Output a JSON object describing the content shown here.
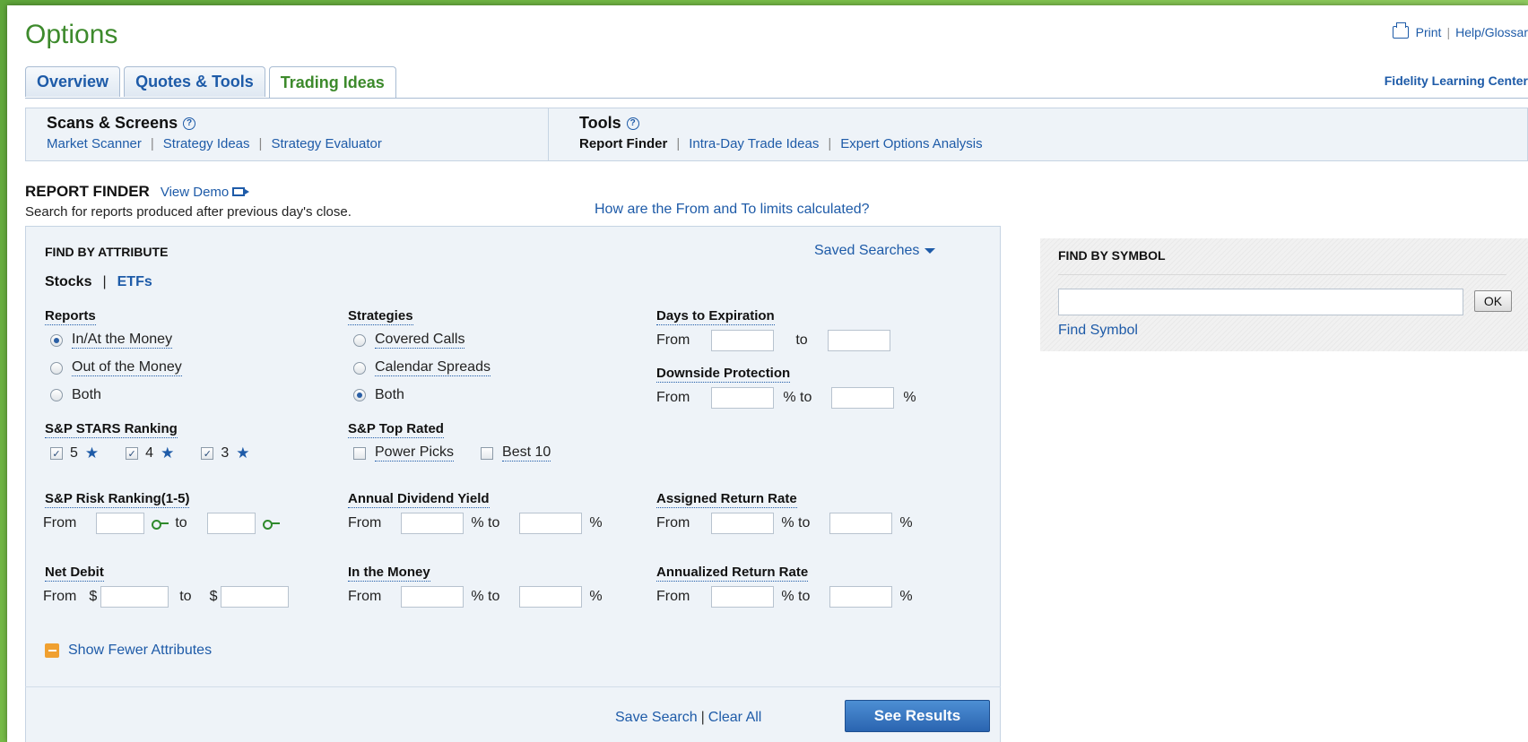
{
  "header": {
    "title": "Options",
    "print": "Print",
    "help": "Help/Glossar",
    "learning_center": "Fidelity Learning Center"
  },
  "tabs": [
    {
      "label": "Overview",
      "active": false
    },
    {
      "label": "Quotes & Tools",
      "active": false
    },
    {
      "label": "Trading Ideas",
      "active": true
    }
  ],
  "nav": {
    "scans_title": "Scans & Screens",
    "scans_links": [
      "Market Scanner",
      "Strategy Ideas",
      "Strategy Evaluator"
    ],
    "tools_title": "Tools",
    "tools_links": [
      "Report Finder",
      "Intra-Day Trade Ideas",
      "Expert Options Analysis"
    ]
  },
  "report_finder": {
    "title": "REPORT FINDER",
    "view_demo": "View Demo",
    "subtitle": "Search for reports produced after previous day's close.",
    "limits_link": "How are the From and To limits calculated?"
  },
  "attribute": {
    "title": "FIND BY ATTRIBUTE",
    "saved_searches": "Saved Searches",
    "type_stocks": "Stocks",
    "type_sep": "|",
    "type_etfs": "ETFs",
    "reports_label": "Reports",
    "reports_options": [
      "In/At the Money",
      "Out of the Money",
      "Both"
    ],
    "strategies_label": "Strategies",
    "strategies_options": [
      "Covered Calls",
      "Calendar Spreads",
      "Both"
    ],
    "days_label": "Days to Expiration",
    "downside_label": "Downside Protection",
    "stars_label": "S&P STARS Ranking",
    "stars_values": [
      "5",
      "4",
      "3"
    ],
    "top_rated_label": "S&P Top Rated",
    "top_rated_options": [
      "Power Picks",
      "Best 10"
    ],
    "risk_label": "S&P Risk Ranking(1-5)",
    "dividend_label": "Annual Dividend Yield",
    "assigned_label": "Assigned Return Rate",
    "net_debit_label": "Net Debit",
    "itm_label": "In the Money",
    "annualized_label": "Annualized Return Rate",
    "from": "From",
    "to": "to",
    "pct": "%",
    "pct_to": "% to",
    "dollar": "$",
    "show_fewer": "Show Fewer Attributes",
    "save_search": "Save Search",
    "bar": "|",
    "clear_all": "Clear All",
    "see_results": "See Results"
  },
  "symbol": {
    "title": "FIND BY SYMBOL",
    "ok": "OK",
    "find_symbol": "Find Symbol"
  }
}
